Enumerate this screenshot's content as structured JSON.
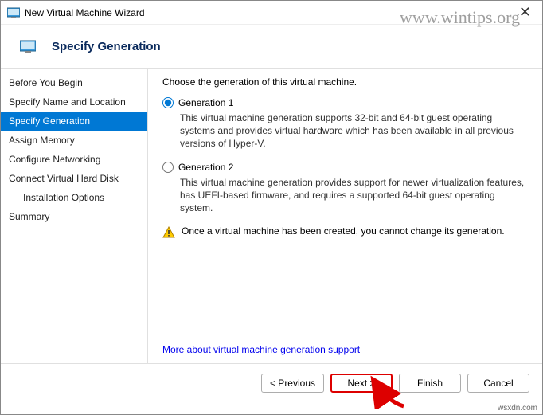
{
  "window": {
    "title": "New Virtual Machine Wizard"
  },
  "watermark": "www.wintips.org",
  "header": {
    "title": "Specify Generation"
  },
  "sidebar": {
    "items": [
      {
        "label": "Before You Begin",
        "selected": false,
        "indent": false
      },
      {
        "label": "Specify Name and Location",
        "selected": false,
        "indent": false
      },
      {
        "label": "Specify Generation",
        "selected": true,
        "indent": false
      },
      {
        "label": "Assign Memory",
        "selected": false,
        "indent": false
      },
      {
        "label": "Configure Networking",
        "selected": false,
        "indent": false
      },
      {
        "label": "Connect Virtual Hard Disk",
        "selected": false,
        "indent": false
      },
      {
        "label": "Installation Options",
        "selected": false,
        "indent": true
      },
      {
        "label": "Summary",
        "selected": false,
        "indent": false
      }
    ]
  },
  "content": {
    "prompt": "Choose the generation of this virtual machine.",
    "options": [
      {
        "label": "Generation 1",
        "checked": true,
        "desc": "This virtual machine generation supports 32-bit and 64-bit guest operating systems and provides virtual hardware which has been available in all previous versions of Hyper-V."
      },
      {
        "label": "Generation 2",
        "checked": false,
        "desc": "This virtual machine generation provides support for newer virtualization features, has UEFI-based firmware, and requires a supported 64-bit guest operating system."
      }
    ],
    "warning": "Once a virtual machine has been created, you cannot change its generation.",
    "more_link": "More about virtual machine generation support"
  },
  "footer": {
    "previous": "< Previous",
    "next": "Next >",
    "finish": "Finish",
    "cancel": "Cancel"
  },
  "source": "wsxdn.com"
}
